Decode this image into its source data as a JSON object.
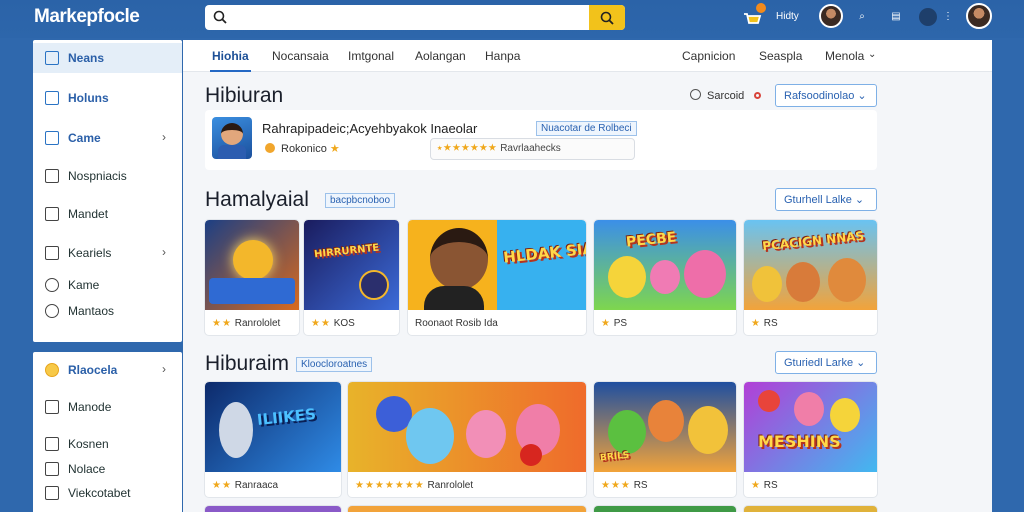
{
  "app": {
    "logo": "Markepfocle",
    "search_placeholder": "",
    "user_name": "Hidty"
  },
  "sidebar": {
    "items": [
      {
        "label": "Neans",
        "icon": "square-icon"
      },
      {
        "label": "Holuns",
        "icon": "expand-icon"
      },
      {
        "label": "Came",
        "icon": "grid-icon"
      },
      {
        "label": "Nospniacis",
        "icon": "list-icon"
      },
      {
        "label": "Mandet",
        "icon": "image-icon"
      },
      {
        "label": "Keariels",
        "icon": "square-icon"
      },
      {
        "label": "Kame",
        "icon": "pin-icon"
      },
      {
        "label": "Mantaos",
        "icon": "circle-icon"
      }
    ],
    "items2": [
      {
        "label": "Rlaocela",
        "icon": "coin-icon"
      },
      {
        "label": "Manode",
        "icon": "image-icon"
      },
      {
        "label": "Kosnen",
        "icon": "doc-icon"
      },
      {
        "label": "Nolace",
        "icon": "check-icon"
      },
      {
        "label": "Viekcotabet",
        "icon": "grid-icon"
      }
    ]
  },
  "tabs": {
    "left": [
      "Hiohia",
      "Nocansaia",
      "Imtgonal",
      "Aolangan",
      "Hanpa"
    ],
    "right": [
      "Capnicion",
      "Seaspla",
      "Menola"
    ]
  },
  "header": {
    "title": "Hibiuran",
    "search_label": "Sarcoid",
    "filter_button": "Rafsoodinolao"
  },
  "featured": {
    "title": "Rahrapipadeic;Acyehbyakok Inaeolar",
    "tag": "Nuacotar de Rolbeci",
    "coin_label": "Rokonico",
    "rating_text": "Ravrlaahecks"
  },
  "sections": [
    {
      "title": "Hamalyaial",
      "tag": "bacpbcnoboo",
      "button": "Gturhell Lalke",
      "cards": [
        {
          "meta": "Ranrololet",
          "art_text": "",
          "colors": [
            "#1c3f84",
            "#d96a1d"
          ]
        },
        {
          "meta": "KOS",
          "art_text": "HIRRURNTE",
          "colors": [
            "#1a1c5e",
            "#3c6bd8"
          ]
        },
        {
          "meta": "Roonaot Rosib Ida",
          "art_text": "HLDAK SIARIES",
          "colors": [
            "#f6b21d",
            "#37b1ef"
          ]
        },
        {
          "meta": "PS",
          "art_text": "PECBE",
          "colors": [
            "#3b8fe8",
            "#7ed64e"
          ]
        },
        {
          "meta": "RS",
          "art_text": "PCACIGN NNAS",
          "colors": [
            "#69c3f2",
            "#f2a33a"
          ]
        }
      ]
    },
    {
      "title": "Hiburaim",
      "tag": "Kloocloroatnes",
      "button": "Gturiedl Larke",
      "cards": [
        {
          "meta": "Ranraaca",
          "art_text": "ILIIKES",
          "colors": [
            "#0d2a6b",
            "#2f8be6"
          ]
        },
        {
          "meta": "Ranrololet",
          "art_text": "",
          "colors": [
            "#e8b32a",
            "#ef6b2b"
          ]
        },
        {
          "meta": "RS",
          "art_text": "BRILS",
          "colors": [
            "#1f4fa0",
            "#f2a33a"
          ]
        },
        {
          "meta": "RS",
          "art_text": "MESHINS",
          "colors": [
            "#b23fd6",
            "#42b8f0"
          ]
        }
      ]
    }
  ],
  "colors": {
    "topbar": "#2b63a8",
    "accent": "#2468c4",
    "search_button": "#f2c21b",
    "star": "#f0a81c"
  }
}
